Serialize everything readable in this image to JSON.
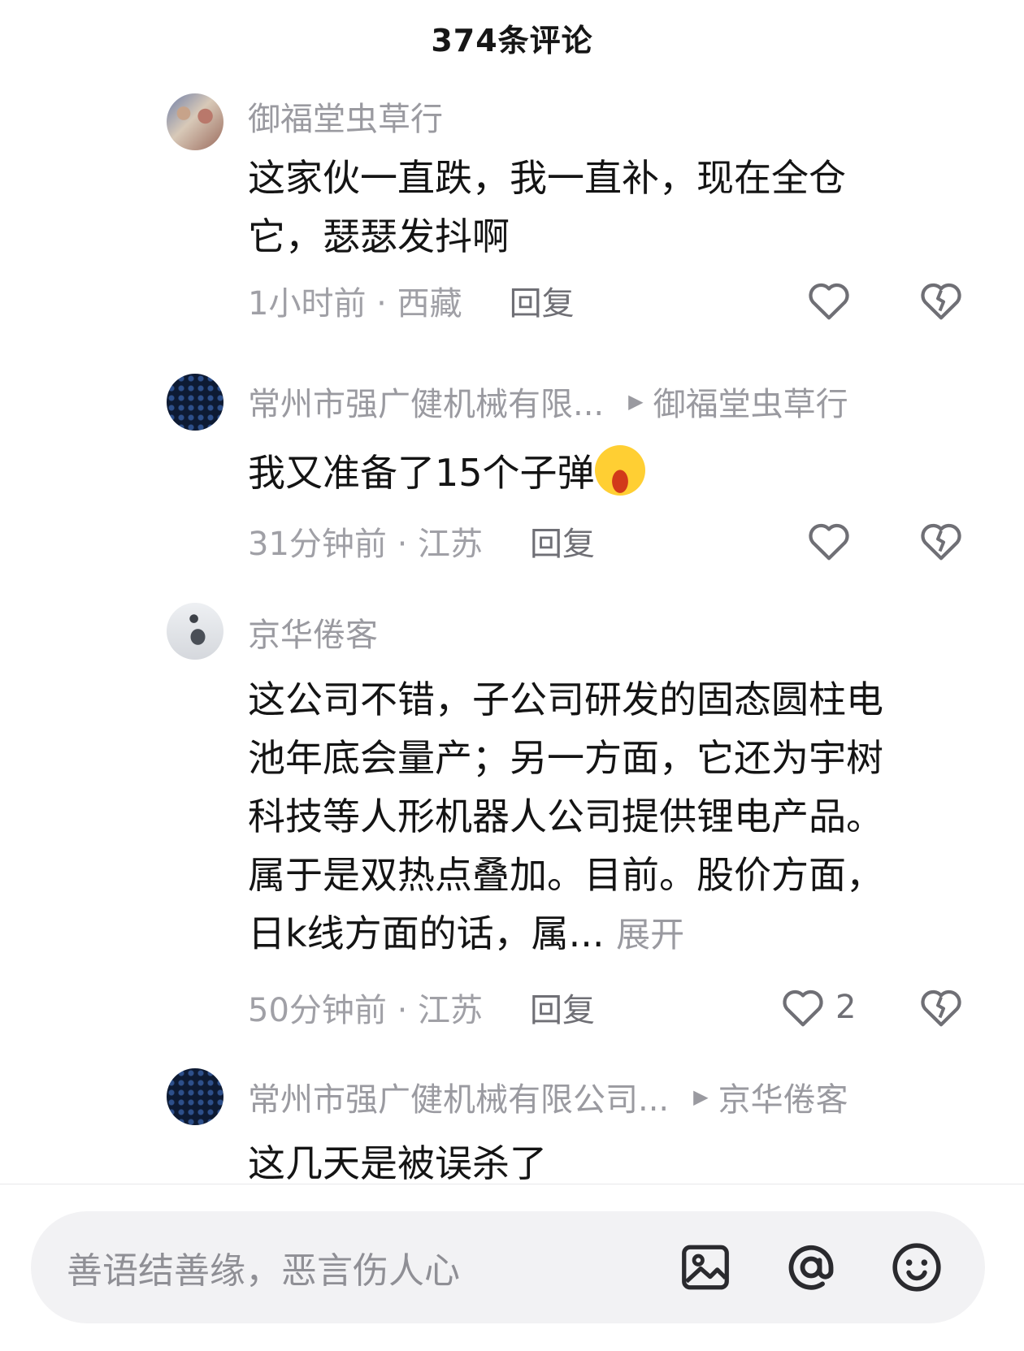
{
  "header": {
    "title": "374条评论"
  },
  "replies": [
    {
      "author": "御福堂虫草行",
      "reply_to": "",
      "content_lines": [
        "这家伙一直跌，我一直补，现在全仓",
        "它，瑟瑟发抖啊"
      ],
      "time_location": "1小时前 · 西藏",
      "reply_label": "回复",
      "likes": "",
      "avatar_icon": "avatar-photo-icon"
    },
    {
      "author": "常州市强广健机械有限...",
      "reply_to": "御福堂虫草行",
      "content_lines": [
        "我又准备了15个子弹"
      ],
      "emoji": "crying-laughing-emoji-icon",
      "time_location": "31分钟前 · 江苏",
      "reply_label": "回复",
      "likes": "",
      "avatar_icon": "avatar-pipes-icon"
    },
    {
      "author": "京华倦客",
      "reply_to": "",
      "content_lines": [
        "这公司不错，子公司研发的固态圆柱电",
        "池年底会量产；另一方面，它还为宇树",
        "科技等人形机器人公司提供锂电产品。",
        "属于是双热点叠加。目前。股价方面，",
        "日k线方面的话，属..."
      ],
      "expand_label": "展开",
      "time_location": "50分钟前 · 江苏",
      "reply_label": "回复",
      "likes": "2",
      "avatar_icon": "avatar-person-icon"
    },
    {
      "author": "常州市强广健机械有限公司...",
      "reply_to": "京华倦客",
      "content_lines": [
        "这几天是被误杀了"
      ],
      "avatar_icon": "avatar-pipes-icon"
    }
  ],
  "input": {
    "placeholder": "善语结善缘，恶言伤人心"
  },
  "toolbar": {
    "image_icon": "image-icon",
    "mention_icon": "at-icon",
    "emoji_icon": "emoji-icon"
  },
  "colors": {
    "muted": "#9a9aa0",
    "text": "#141414",
    "input_bg": "#f2f2f4"
  }
}
